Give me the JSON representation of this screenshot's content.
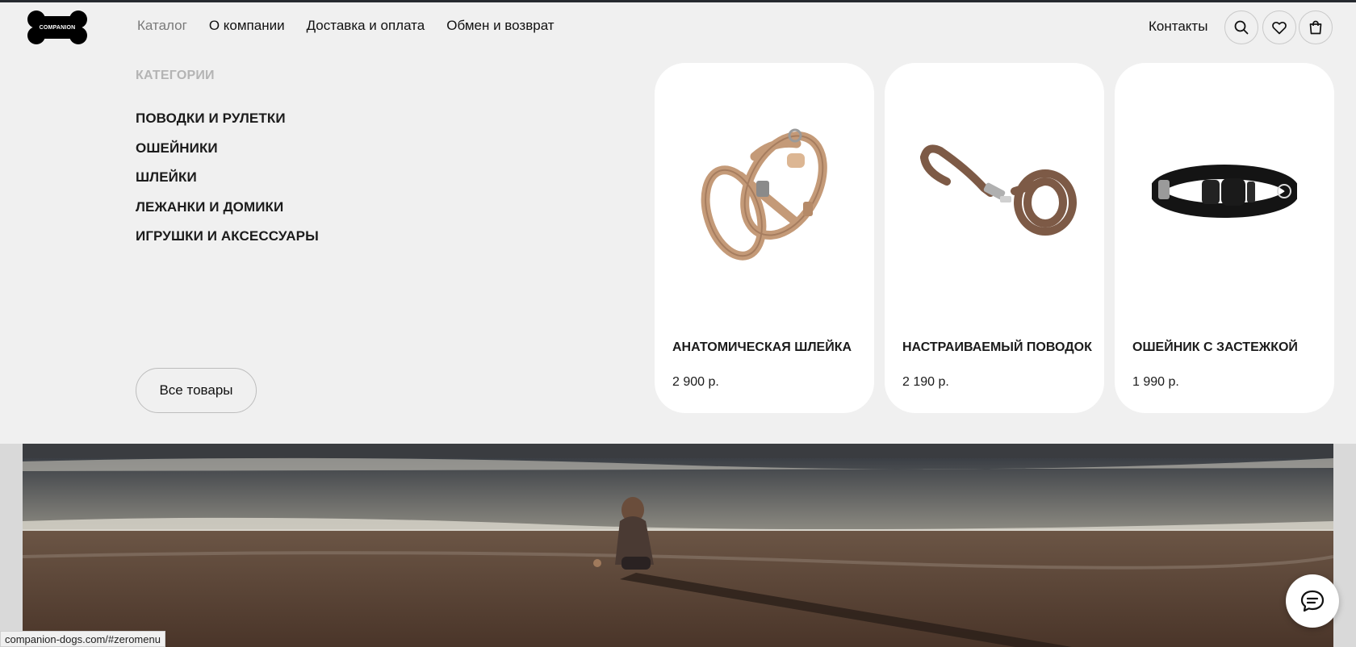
{
  "header": {
    "logo_text": "COMPANION",
    "nav": [
      {
        "label": "Каталог",
        "active": true
      },
      {
        "label": "О компании",
        "active": false
      },
      {
        "label": "Доставка и оплата",
        "active": false
      },
      {
        "label": "Обмен и возврат",
        "active": false
      }
    ],
    "contacts_label": "Контакты",
    "icons": [
      "search-icon",
      "heart-icon",
      "cart-icon"
    ]
  },
  "menu": {
    "categories_title": "КАТЕГОРИИ",
    "categories": [
      "ПОВОДКИ И РУЛЕТКИ",
      "ОШЕЙНИКИ",
      "ШЛЕЙКИ",
      "ЛЕЖАНКИ И ДОМИКИ",
      "ИГРУШКИ И АКСЕССУАРЫ"
    ],
    "all_products_label": "Все товары",
    "products": [
      {
        "name": "АНАТОМИЧЕСКАЯ ШЛЕЙКА",
        "price": "2 900 р.",
        "icon": "harness-image"
      },
      {
        "name": "НАСТРАИВАЕМЫЙ ПОВОДОК",
        "price": "2 190 р.",
        "icon": "leash-image"
      },
      {
        "name": "ОШЕЙНИК С ЗАСТЕЖКОЙ",
        "price": "1 990 р.",
        "icon": "collar-image"
      }
    ]
  },
  "status_bar": {
    "url": "companion-dogs.com/#zeromenu"
  },
  "colors": {
    "topbar": "#262a2f",
    "background": "#f0f0f0",
    "card": "#ffffff",
    "muted": "#b4b4b4",
    "leather": "#c49a78",
    "leash": "#7d5a46"
  }
}
